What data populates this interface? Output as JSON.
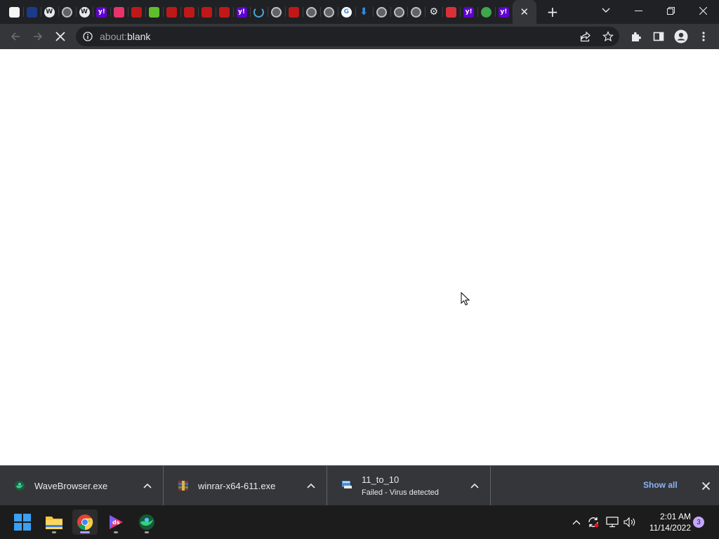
{
  "browser": {
    "tabs": [
      {
        "icon": "clipboard-icon",
        "color": "#f5f5f5",
        "glyph": ""
      },
      {
        "icon": "blue-site-icon",
        "color": "#1a3a8c",
        "glyph": ""
      },
      {
        "icon": "wordpress-icon",
        "color": "#e8eaed",
        "glyph": "W"
      },
      {
        "icon": "globe-icon",
        "color": "#bdc1c6",
        "glyph": ""
      },
      {
        "icon": "wordpress-icon",
        "color": "#e8eaed",
        "glyph": "W"
      },
      {
        "icon": "yahoo-icon",
        "color": "#6001d2",
        "glyph": "y!"
      },
      {
        "icon": "media-icon",
        "color": "#e8336b",
        "glyph": ""
      },
      {
        "icon": "mcafee-icon",
        "color": "#c01818",
        "glyph": ""
      },
      {
        "icon": "green-leaf-icon",
        "color": "#5fbf2a",
        "glyph": ""
      },
      {
        "icon": "mcafee-icon",
        "color": "#c01818",
        "glyph": ""
      },
      {
        "icon": "mcafee-icon",
        "color": "#c01818",
        "glyph": ""
      },
      {
        "icon": "mcafee-icon",
        "color": "#c01818",
        "glyph": ""
      },
      {
        "icon": "mcafee-icon",
        "color": "#c01818",
        "glyph": ""
      },
      {
        "icon": "yahoo-icon",
        "color": "#6001d2",
        "glyph": "y!"
      },
      {
        "icon": "loading-icon",
        "color": "#4ea5d9",
        "glyph": ""
      },
      {
        "icon": "globe-icon",
        "color": "#bdc1c6",
        "glyph": ""
      },
      {
        "icon": "mcafee-icon",
        "color": "#c01818",
        "glyph": ""
      },
      {
        "icon": "globe-icon",
        "color": "#bdc1c6",
        "glyph": ""
      },
      {
        "icon": "globe-icon",
        "color": "#bdc1c6",
        "glyph": ""
      },
      {
        "icon": "google-icon",
        "color": "#ffffff",
        "glyph": "G"
      },
      {
        "icon": "download-icon",
        "color": "#2b8ee8",
        "glyph": ""
      },
      {
        "icon": "globe-icon",
        "color": "#bdc1c6",
        "glyph": ""
      },
      {
        "icon": "globe-icon",
        "color": "#bdc1c6",
        "glyph": ""
      },
      {
        "icon": "globe-icon",
        "color": "#bdc1c6",
        "glyph": ""
      },
      {
        "icon": "settings-icon",
        "color": "#e8eaed",
        "glyph": ""
      },
      {
        "icon": "shield-icon",
        "color": "#d9313a",
        "glyph": ""
      },
      {
        "icon": "yahoo-icon",
        "color": "#6001d2",
        "glyph": "y!"
      },
      {
        "icon": "wave-icon",
        "color": "#3ea84a",
        "glyph": ""
      },
      {
        "icon": "yahoo-icon",
        "color": "#6001d2",
        "glyph": "y!"
      }
    ],
    "address": {
      "scheme": "about:",
      "host": "blank"
    }
  },
  "downloads": [
    {
      "name": "WaveBrowser.exe",
      "status": "",
      "icon": "wavebrowser-icon"
    },
    {
      "name": "winrar-x64-611.exe",
      "status": "",
      "icon": "winrar-icon"
    },
    {
      "name": "11_to_10",
      "status": "Failed - Virus detected",
      "icon": "installer-icon"
    }
  ],
  "shelf": {
    "show_all": "Show all"
  },
  "taskbar": {
    "time": "2:01 AM",
    "date": "11/14/2022",
    "notifications": "3"
  },
  "colors": {
    "accent": "#8ab4f8",
    "chrome_dark": "#202124",
    "toolbar": "#35363a"
  }
}
